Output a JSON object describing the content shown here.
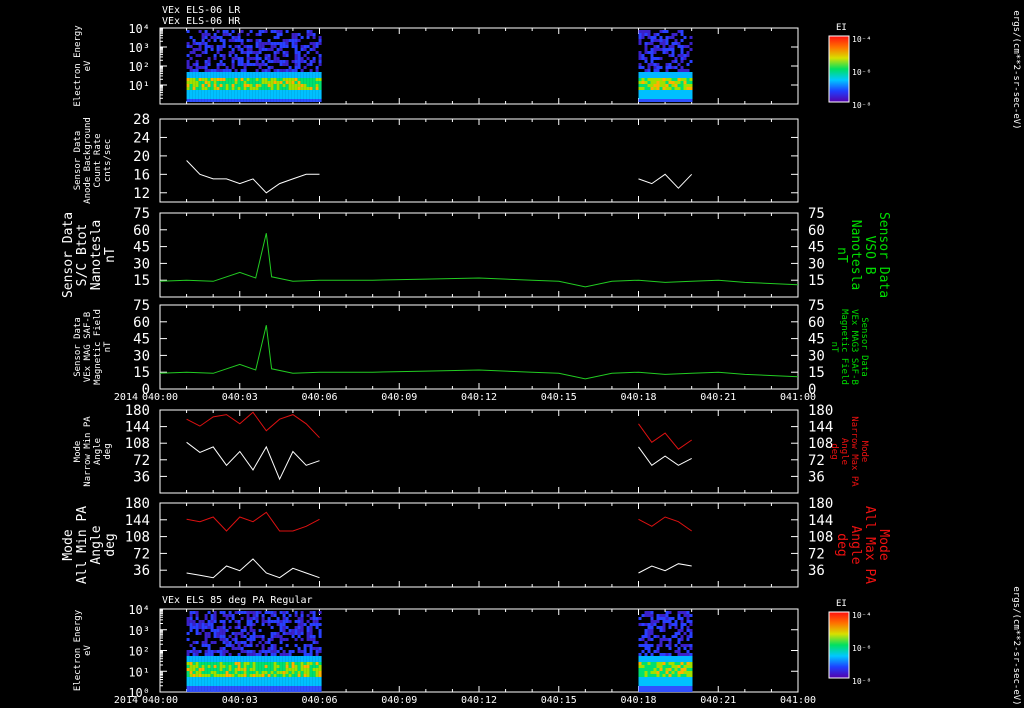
{
  "header": {
    "line1": "VEx ELS-06 LR",
    "line2": "VEx ELS-06 HR"
  },
  "bottom_panel_title": "VEx ELS 85 deg PA Regular",
  "colorbar": {
    "label": "EI",
    "units": "ergs/(cm**2-sr-sec-eV)",
    "tick_labels": [
      "10⁻⁴",
      "10⁻⁶",
      "10⁻⁸"
    ]
  },
  "time_axis": {
    "year": "2014",
    "ticks": [
      "040:00",
      "040:03",
      "040:06",
      "040:09",
      "040:12",
      "040:15",
      "040:18",
      "040:21",
      "041:00"
    ]
  },
  "colors": {
    "white_trace": "#ffffff",
    "green_trace": "#22cc22",
    "green_label": "#00dd00",
    "red_trace": "#dd1111",
    "red_label": "#ee1111",
    "axis": "#ffffff",
    "background": "#000000"
  },
  "panels": [
    {
      "id": "p1",
      "left_label": [
        "Electron Energy",
        "eV"
      ],
      "y_ticks": [
        "10⁴",
        "10³",
        "10²",
        "10¹"
      ],
      "y_tick_labels_text": [
        "10^4",
        "10^3",
        "10^2",
        "10"
      ]
    },
    {
      "id": "p2",
      "left_label": [
        "Sensor Data",
        "Anode Background",
        "Count Rate",
        "cnts/sec"
      ],
      "y_ticks": [
        "28",
        "24",
        "20",
        "16",
        "12"
      ]
    },
    {
      "id": "p3",
      "left_label": [
        "Sensor Data",
        "S/C Btot",
        "Nanotesla",
        "nT"
      ],
      "right_label": [
        "Sensor Data",
        "VSO B",
        "Nanotesla",
        "nT"
      ],
      "y_ticks": [
        "75",
        "60",
        "45",
        "30",
        "15"
      ]
    },
    {
      "id": "p4",
      "left_label": [
        "Sensor Data",
        "VEx MAG SAF-B",
        "Magnetic Field",
        "nT"
      ],
      "right_label": [
        "Sensor Data",
        "VEx MAG3 SAF-B",
        "Magnetic Field",
        "nT"
      ],
      "y_ticks": [
        "75",
        "60",
        "45",
        "30",
        "15",
        "0"
      ]
    },
    {
      "id": "p5",
      "left_label": [
        "Mode",
        "Narrow Min PA",
        "Angle",
        "deg"
      ],
      "right_label": [
        "Mode",
        "Narrow Max PA",
        "Angle",
        "deg"
      ],
      "y_ticks": [
        "180",
        "144",
        "108",
        "72",
        "36"
      ]
    },
    {
      "id": "p6",
      "left_label": [
        "Mode",
        "All Min PA",
        "Angle",
        "deg"
      ],
      "right_label": [
        "Mode",
        "All Max PA",
        "Angle",
        "deg"
      ],
      "y_ticks": [
        "180",
        "144",
        "108",
        "72",
        "36"
      ]
    },
    {
      "id": "p7",
      "left_label": [
        "Electron Energy",
        "eV"
      ],
      "y_ticks": [
        "10⁴",
        "10³",
        "10²",
        "10¹",
        "10⁰"
      ]
    }
  ],
  "chart_data": [
    {
      "type": "heatmap",
      "panel": "Electron Energy (ELS-06 LR/HR)",
      "xlabel": "",
      "ylabel": "Electron Energy eV",
      "y_scale": "log",
      "ylim": [
        1,
        10000
      ],
      "x_range": [
        "040:00",
        "041:00"
      ],
      "data_intervals": [
        [
          "040:01",
          "040:06"
        ],
        [
          "040:18",
          "040:20"
        ]
      ]
    },
    {
      "type": "line",
      "panel": "Anode Background Count Rate",
      "ylabel": "cnts/sec",
      "ylim": [
        10,
        28
      ],
      "series": [
        {
          "x": [
            "040:01",
            "040:01.5",
            "040:02",
            "040:02.5",
            "040:03",
            "040:03.5",
            "040:04",
            "040:04.5",
            "040:05",
            "040:05.5",
            "040:06"
          ],
          "values": [
            19,
            16,
            15,
            15,
            14,
            15,
            12,
            14,
            15,
            16,
            16
          ]
        },
        {
          "x": [
            "040:18",
            "040:18.5",
            "040:19",
            "040:19.5",
            "040:20"
          ],
          "values": [
            15,
            14,
            16,
            13,
            16
          ]
        }
      ]
    },
    {
      "type": "line",
      "panel": "S/C Btot / VSO B",
      "ylabel": "nT",
      "ylim": [
        0,
        75
      ],
      "series": [
        {
          "x": [
            "040:00",
            "040:01",
            "040:02",
            "040:03",
            "040:03.6",
            "040:04",
            "040:04.2",
            "040:05",
            "040:06",
            "040:08",
            "040:10",
            "040:12",
            "040:14",
            "040:15",
            "040:16",
            "040:17",
            "040:18",
            "040:19",
            "040:20",
            "040:21",
            "040:22",
            "041:00"
          ],
          "values": [
            14,
            15,
            14,
            22,
            17,
            57,
            18,
            14,
            15,
            15,
            16,
            17,
            15,
            14,
            9,
            14,
            15,
            13,
            14,
            15,
            13,
            11
          ]
        }
      ]
    },
    {
      "type": "line",
      "panel": "VEx MAG SAF-B",
      "ylabel": "nT",
      "ylim": [
        0,
        75
      ],
      "series": [
        {
          "x": [
            "040:00",
            "040:01",
            "040:02",
            "040:03",
            "040:03.6",
            "040:04",
            "040:04.2",
            "040:05",
            "040:06",
            "040:08",
            "040:10",
            "040:12",
            "040:14",
            "040:15",
            "040:16",
            "040:17",
            "040:18",
            "040:19",
            "040:20",
            "040:21",
            "040:22",
            "041:00"
          ],
          "values": [
            14,
            15,
            14,
            22,
            17,
            57,
            18,
            14,
            15,
            15,
            16,
            17,
            15,
            14,
            9,
            14,
            15,
            13,
            14,
            15,
            13,
            11
          ]
        }
      ]
    },
    {
      "type": "line",
      "panel": "Narrow Min/Max PA Angle",
      "ylabel": "deg",
      "ylim": [
        0,
        180
      ],
      "series": [
        {
          "x": [
            "040:01",
            "040:01.5",
            "040:02",
            "040:02.5",
            "040:03",
            "040:03.5",
            "040:04",
            "040:04.5",
            "040:05",
            "040:05.5",
            "040:06",
            "040:18",
            "040:18.5",
            "040:19",
            "040:19.5",
            "040:20"
          ],
          "values": [
            110,
            88,
            100,
            60,
            90,
            50,
            100,
            30,
            90,
            60,
            70,
            100,
            60,
            80,
            60,
            75
          ]
        },
        {
          "x": [
            "040:01",
            "040:01.5",
            "040:02",
            "040:02.5",
            "040:03",
            "040:03.5",
            "040:04",
            "040:04.5",
            "040:05",
            "040:05.5",
            "040:06",
            "040:18",
            "040:18.5",
            "040:19",
            "040:19.5",
            "040:20"
          ],
          "values": [
            160,
            145,
            165,
            170,
            150,
            175,
            135,
            160,
            170,
            150,
            120,
            150,
            110,
            130,
            95,
            115
          ]
        }
      ]
    },
    {
      "type": "line",
      "panel": "All Min/Max PA Angle",
      "ylabel": "deg",
      "ylim": [
        0,
        180
      ],
      "series": [
        {
          "x": [
            "040:01",
            "040:01.5",
            "040:02",
            "040:02.5",
            "040:03",
            "040:03.5",
            "040:04",
            "040:04.5",
            "040:05",
            "040:05.5",
            "040:06",
            "040:18",
            "040:18.5",
            "040:19",
            "040:19.5",
            "040:20"
          ],
          "values": [
            30,
            25,
            20,
            45,
            35,
            60,
            30,
            20,
            40,
            30,
            20,
            30,
            45,
            35,
            50,
            45
          ]
        },
        {
          "x": [
            "040:01",
            "040:01.5",
            "040:02",
            "040:02.5",
            "040:03",
            "040:03.5",
            "040:04",
            "040:04.5",
            "040:05",
            "040:05.5",
            "040:06",
            "040:18",
            "040:18.5",
            "040:19",
            "040:19.5",
            "040:20"
          ],
          "values": [
            145,
            140,
            150,
            120,
            150,
            140,
            160,
            120,
            120,
            130,
            145,
            145,
            130,
            150,
            140,
            120
          ]
        }
      ]
    },
    {
      "type": "heatmap",
      "panel": "Electron Energy (ELS 85 deg PA Regular)",
      "ylabel": "Electron Energy eV",
      "y_scale": "log",
      "ylim": [
        1,
        10000
      ],
      "x_range": [
        "040:00",
        "041:00"
      ],
      "data_intervals": [
        [
          "040:01",
          "040:06"
        ],
        [
          "040:18",
          "040:20"
        ]
      ]
    }
  ]
}
